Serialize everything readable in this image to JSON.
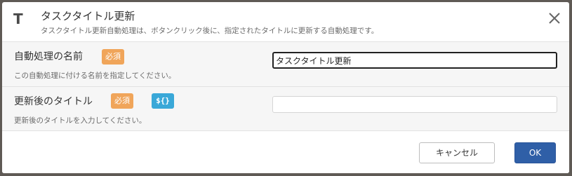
{
  "header": {
    "icon": "T",
    "title": "タスクタイトル更新",
    "subtitle": "タスクタイトル更新自動処理は、ボタンクリック後に、指定されたタイトルに更新する自動処理です。"
  },
  "fields": [
    {
      "label": "自動処理の名前",
      "required_badge": "必須",
      "description": "この自動処理に付ける名前を指定してください。",
      "value": "タスクタイトル更新",
      "placeholder": ""
    },
    {
      "label": "更新後のタイトル",
      "required_badge": "必須",
      "variable_badge": "${}",
      "description": "更新後のタイトルを入力してください。",
      "value": "",
      "placeholder": ""
    }
  ],
  "footer": {
    "cancel_label": "キャンセル",
    "ok_label": "OK"
  },
  "icons": {
    "close": "close-icon",
    "title_type": "text-type-icon"
  },
  "colors": {
    "required_badge": "#f0a55a",
    "variable_badge": "#3aa8d8",
    "ok_button": "#2f5fa7"
  }
}
